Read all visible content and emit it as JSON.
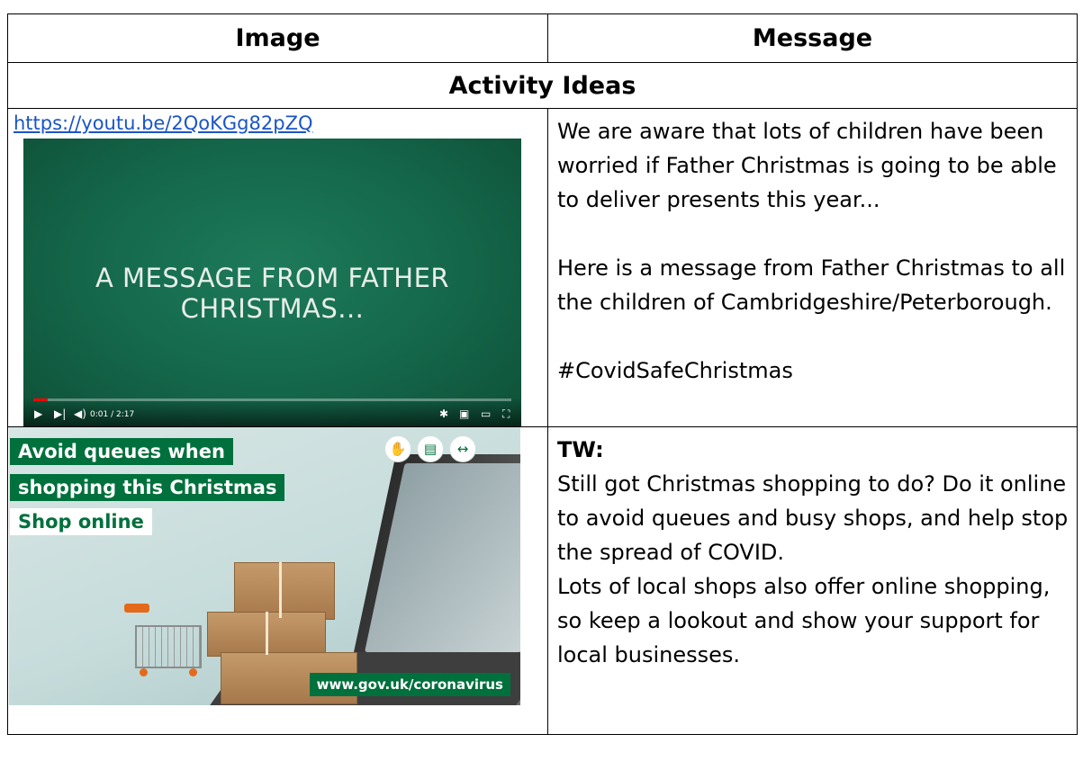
{
  "header": {
    "col1": "Image",
    "col2": "Message"
  },
  "section_title": "Activity Ideas",
  "row1": {
    "link": "https://youtu.be/2QoKGg82pZQ",
    "video": {
      "title": "A MESSAGE FROM FATHER CHRISTMAS...",
      "time": "0:01 / 2:17",
      "progress": 0.008,
      "icons": [
        "play-icon",
        "next-icon",
        "volume-icon",
        "settings-icon",
        "miniplayer-icon",
        "theater-icon",
        "fullscreen-icon"
      ]
    },
    "message": {
      "p1": "We are aware that lots of children have been worried if Father Christmas is going to be able to deliver presents this year...",
      "p2": "Here is a message from Father Christmas to all the children of Cambridgeshire/Peterborough.",
      "hashtag": "#CovidSafeChristmas"
    }
  },
  "row2": {
    "promo": {
      "line1": "Avoid queues when",
      "line2": "shopping this Christmas",
      "line3": "Shop online",
      "url": "www.gov.uk/coronavirus",
      "colors": {
        "gov_green": "#00703c"
      },
      "badges": [
        "hands-icon",
        "face-mask-icon",
        "distance-icon"
      ]
    },
    "message": {
      "tag": "TW:",
      "p1": "Still got Christmas shopping to do? Do it online to avoid queues and busy shops, and help stop the spread of COVID.",
      "p2": "Lots of local shops also offer online shopping, so keep a lookout and show your support for local businesses."
    }
  }
}
